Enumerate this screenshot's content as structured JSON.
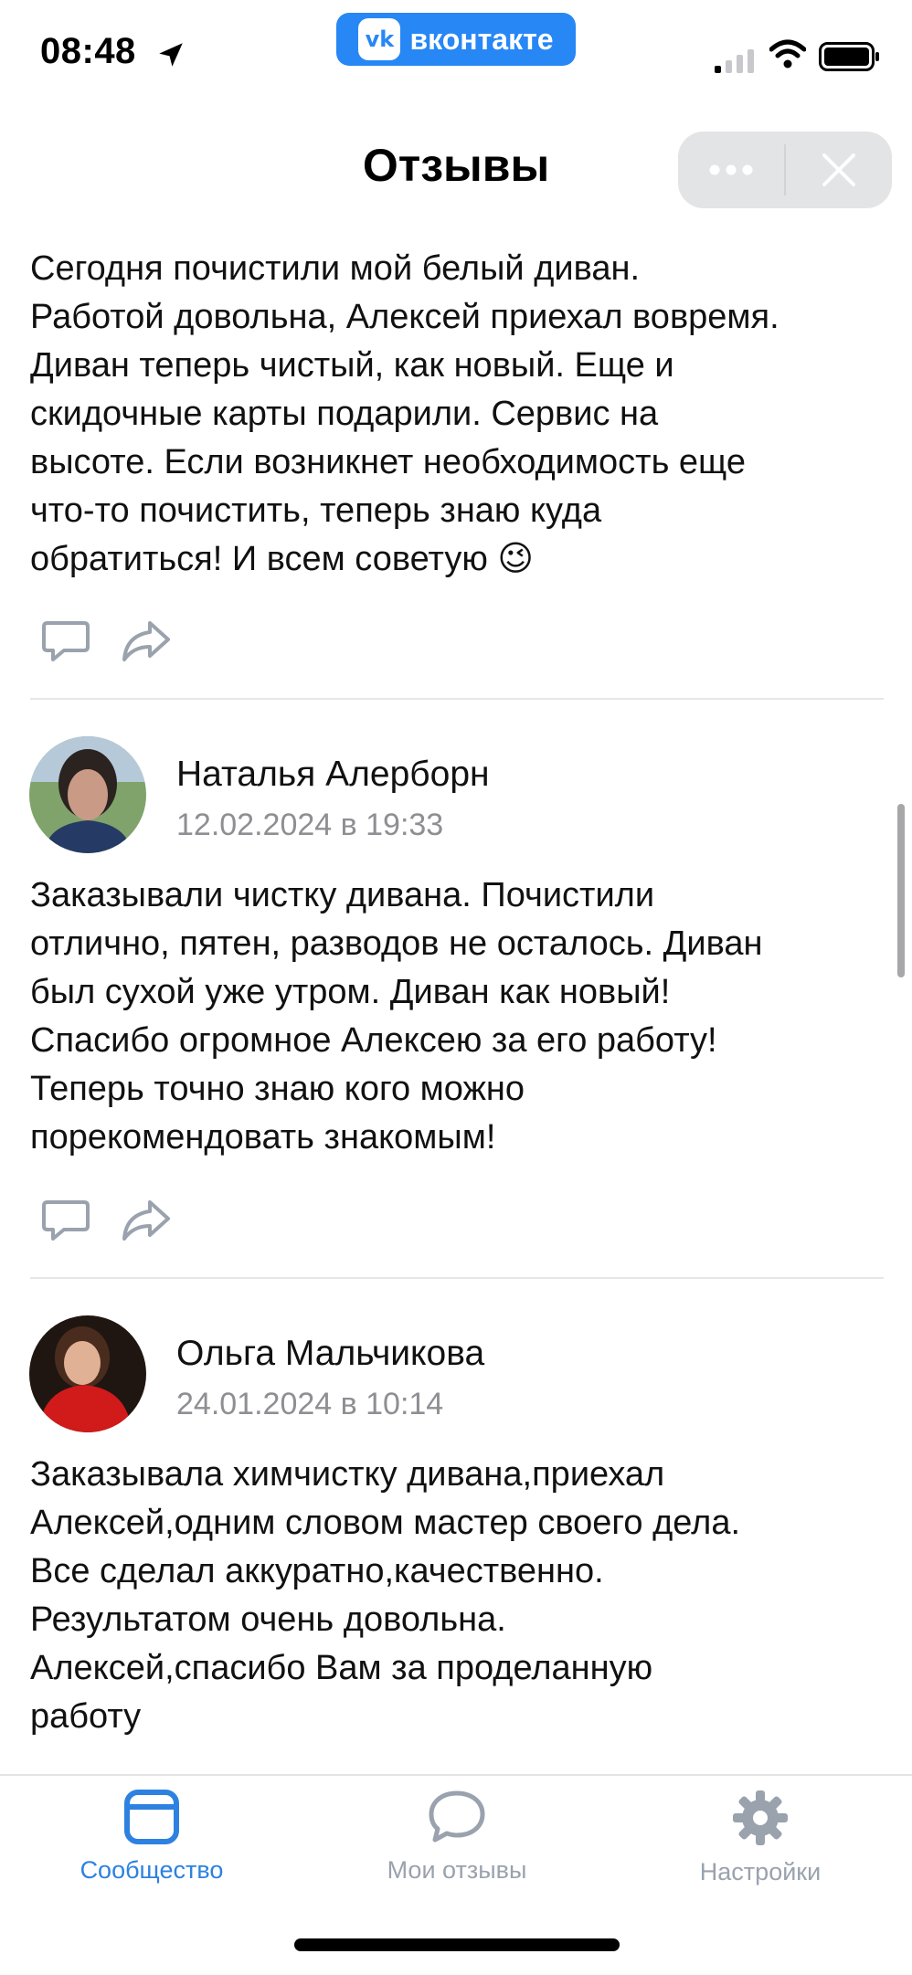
{
  "status_bar": {
    "time": "08:48",
    "app_badge": "вконтакте"
  },
  "nav": {
    "title": "Отзывы"
  },
  "reviews": [
    {
      "text_lines": [
        "Сегодня почистили мой белый диван.",
        "Работой довольна, Алексей приехал вовремя.",
        "Диван теперь чистый, как новый. Еще и",
        "скидочные карты подарили. Сервис на",
        "высоте. Если возникнет необходимость еще",
        "что-то почистить, теперь знаю куда",
        "обратиться! И всем советую"
      ],
      "emoji": "😉"
    },
    {
      "author": "Наталья Алерборн",
      "date": "12.02.2024 в 19:33",
      "text_lines": [
        "Заказывали чистку дивана. Почистили",
        "отлично, пятен, разводов не осталось. Диван",
        "был сухой уже утром. Диван как новый!",
        "Спасибо огромное Алексею за его работу!",
        "Теперь точно знаю кого можно",
        "порекомендовать знакомым!"
      ]
    },
    {
      "author": "Ольга Мальчикова",
      "date": "24.01.2024 в 10:14",
      "text_lines": [
        "Заказывала химчистку дивана,приехал",
        "Алексей,одним словом мастер своего дела.",
        "Все сделал аккуратно,качественно.",
        "Результатом очень довольна.",
        "Алексей,спасибо Вам за проделанную",
        "работу"
      ]
    }
  ],
  "tabs": [
    {
      "label": "Сообщество",
      "icon": "community-icon",
      "active": true
    },
    {
      "label": "Мои отзывы",
      "icon": "chat-bubble-icon",
      "active": false
    },
    {
      "label": "Настройки",
      "icon": "gear-icon",
      "active": false
    }
  ],
  "colors": {
    "accent": "#2787f5",
    "tab_active": "#2d81e0",
    "tab_inactive": "#99a2ad",
    "secondary_text": "#8e8e93"
  }
}
